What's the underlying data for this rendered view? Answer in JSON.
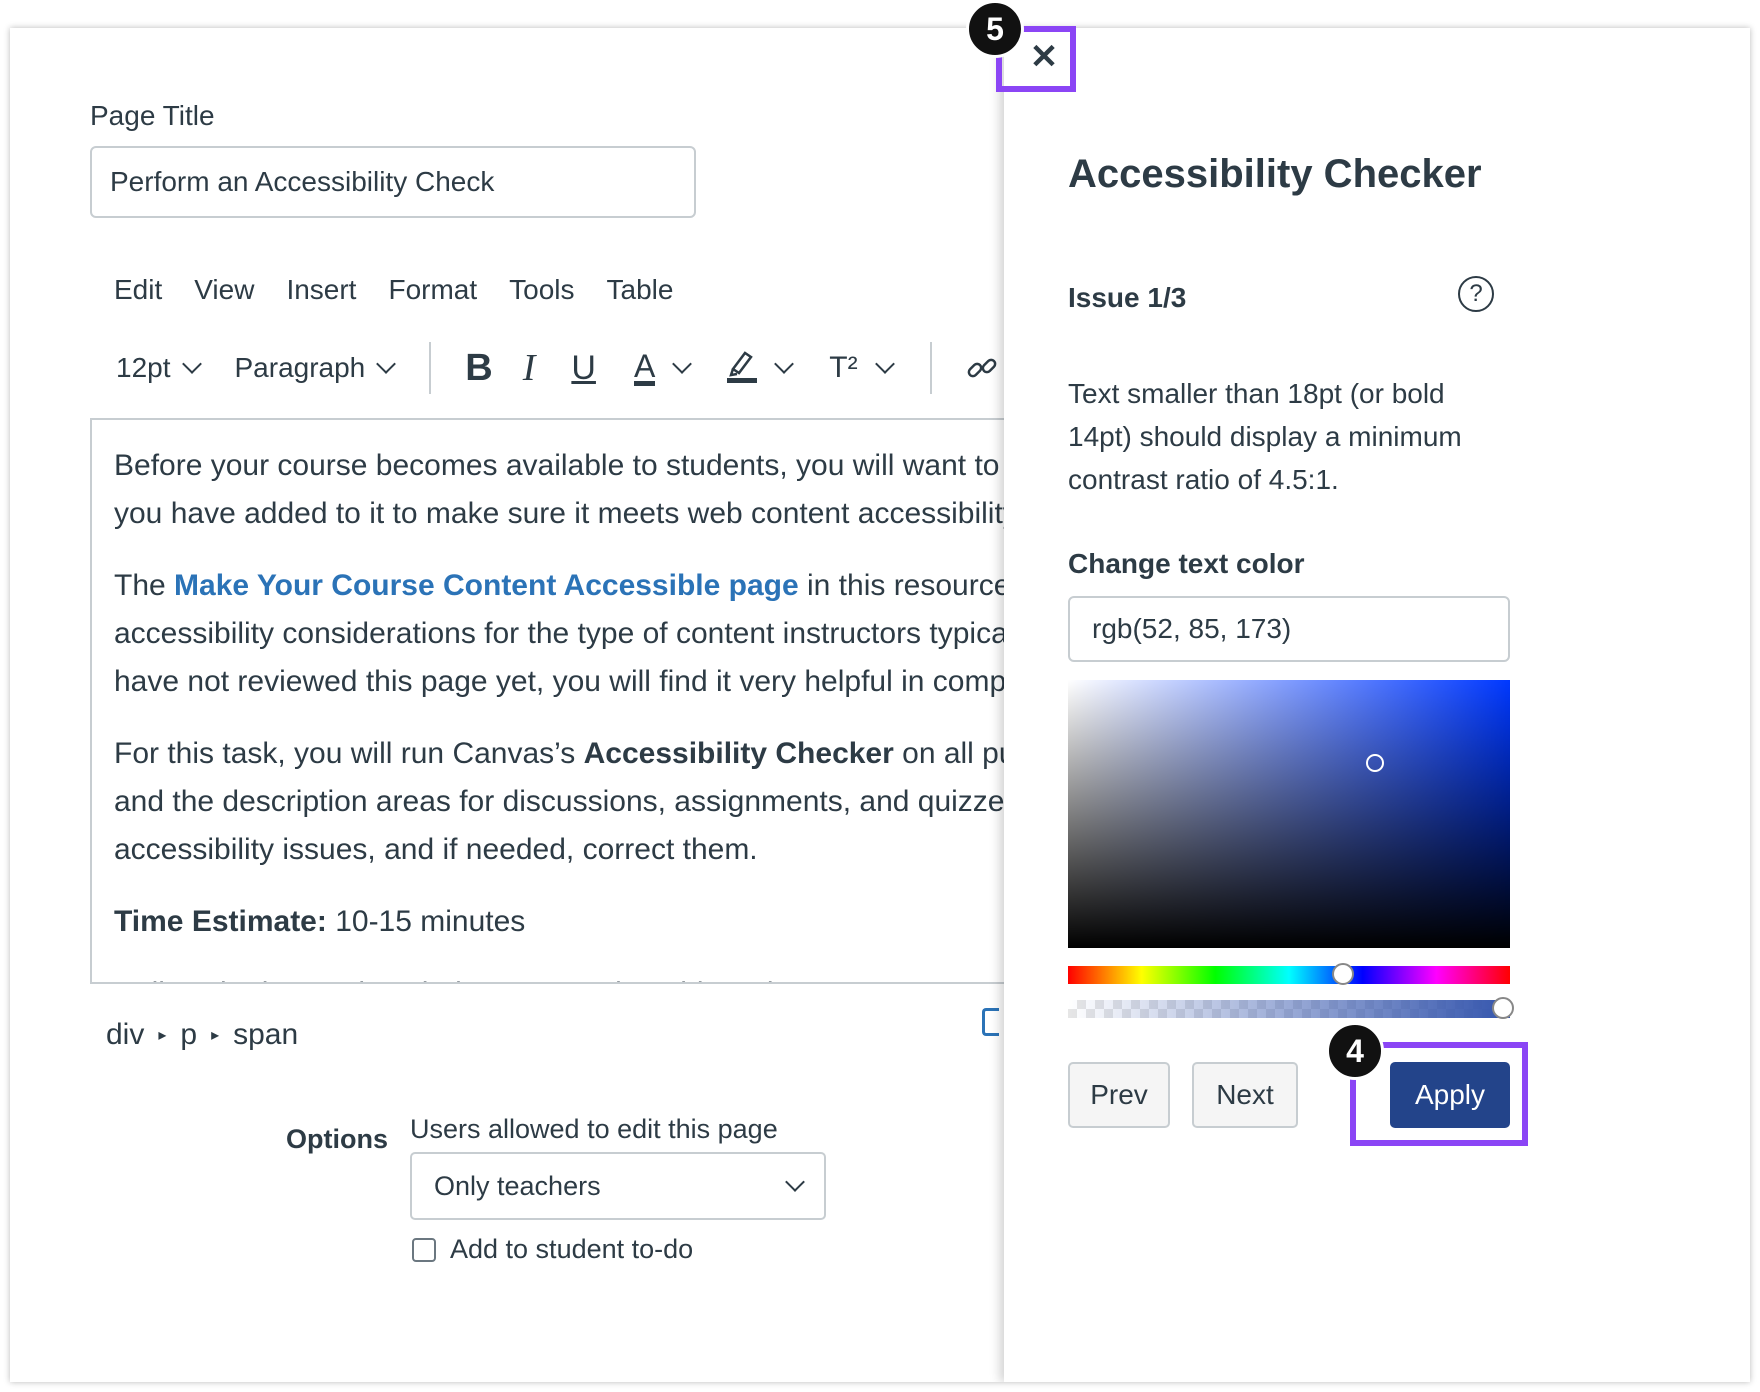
{
  "editor": {
    "page_title_label": "Page Title",
    "page_title_value": "Perform an Accessibility Check",
    "menu": [
      "Edit",
      "View",
      "Insert",
      "Format",
      "Tools",
      "Table"
    ],
    "toolbar": {
      "font_size": "12pt",
      "block_format": "Paragraph",
      "bold_glyph": "B",
      "italic_glyph": "I",
      "underline_glyph": "U",
      "text_color_glyph": "A",
      "superscript_glyph": "T²"
    },
    "content": {
      "p1_line1": "Before your course becomes available to students, you will want to do",
      "p1_line2": "you have added to it to make sure it meets web content accessibility g",
      "p2_prefix": "The ",
      "p2_link": "Make Your Course Content Accessible page",
      "p2_suffix": " in this resource co",
      "p2_line2": "accessibility considerations for the type of content instructors typically",
      "p2_line3": "have not reviewed this page yet, you will find it very helpful in completi",
      "p3_prefix": "For this task, you will run Canvas’s ",
      "p3_bold": "Accessibility Checker",
      "p3_suffix": " on all publis",
      "p3_line2": "and the description areas for discussions, assignments, and quizzes in",
      "p3_line3": "accessibility issues, and if needed, correct them.",
      "time_label": "Time Estimate:",
      "time_value": " 10-15 minutes",
      "follow": "Follow the instructions below to complete this task."
    },
    "breadcrumb": [
      "div",
      "p",
      "span"
    ],
    "breadcrumb_sep": "▸",
    "options_label": "Options",
    "edit_permission_label": "Users allowed to edit this page",
    "edit_permission_value": "Only teachers",
    "todo_label": "Add to student to-do"
  },
  "panel": {
    "close_glyph": "✕",
    "title": "Accessibility Checker",
    "issue": "Issue 1/3",
    "help_glyph": "?",
    "description": "Text smaller than 18pt (or bold 14pt) should display a minimum contrast ratio of 4.5:1.",
    "change_label": "Change text color",
    "color_value": "rgb(52, 85, 173)",
    "prev_label": "Prev",
    "next_label": "Next",
    "apply_label": "Apply"
  },
  "annotations": {
    "close_step": "5",
    "apply_step": "4",
    "highlight_color": "#8b45f5"
  },
  "colors": {
    "link": "#2b73b7",
    "apply_bg": "#23448a"
  }
}
